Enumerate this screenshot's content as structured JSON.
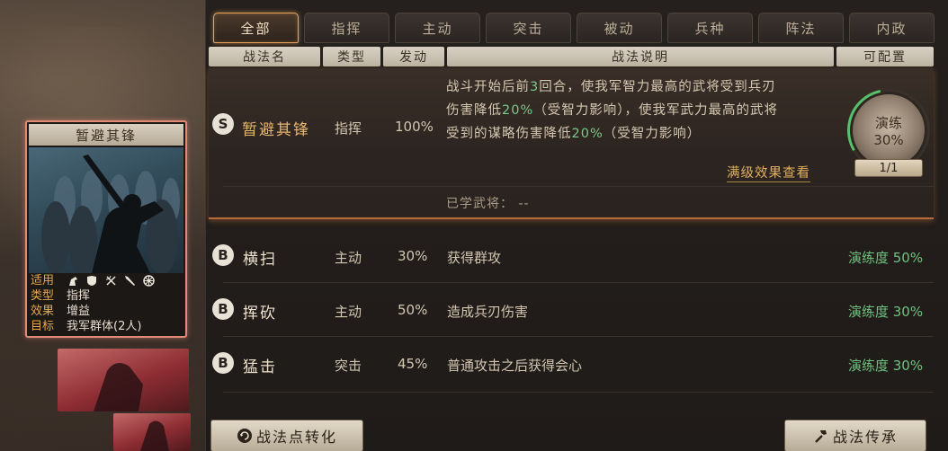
{
  "tabs": [
    "全部",
    "指挥",
    "主动",
    "突击",
    "被动",
    "兵种",
    "阵法",
    "内政"
  ],
  "header": {
    "name": "战法名",
    "type": "类型",
    "rate": "发动",
    "desc": "战法说明",
    "configurable": "可配置"
  },
  "selected": {
    "rank": "S",
    "name": "暂避其锋",
    "type": "指挥",
    "rate": "100%",
    "desc_line1": "战斗开始后前",
    "desc_num1": "3",
    "desc_line1b": "回合，使我军智力最高的武将受到兵刃",
    "desc_line2a": "伤害降低",
    "desc_pct1": "20%",
    "desc_line2b": "（受智力影响），使我军武力最高的武将",
    "desc_line3a": "受到的谋略伤害降低",
    "desc_pct2": "20%",
    "desc_line3b": "（受智力影响）",
    "full_effect_link": "满级效果查看",
    "learned_label": "已学武将：",
    "learned_value": "--",
    "practice_label": "演练",
    "practice_pct": "30%",
    "practice_count": "1/1",
    "practice_progress": 0.3
  },
  "rows": [
    {
      "rank": "B",
      "name": "横扫",
      "type": "主动",
      "rate": "30%",
      "desc": "获得群攻",
      "progress": "演练度 50%"
    },
    {
      "rank": "B",
      "name": "挥砍",
      "type": "主动",
      "rate": "50%",
      "desc": "造成兵刃伤害",
      "progress": "演练度 30%"
    },
    {
      "rank": "B",
      "name": "猛击",
      "type": "突击",
      "rate": "45%",
      "desc": "普通攻击之后获得会心",
      "progress": "演练度 30%"
    }
  ],
  "card": {
    "title": "暂避其锋",
    "applies_label": "适用",
    "type_label": "类型",
    "type_value": "指挥",
    "effect_label": "效果",
    "effect_value": "增益",
    "target_label": "目标",
    "target_value": "我军群体(2人)",
    "arm_icons": [
      "cavalry-icon",
      "shield-icon",
      "bow-icon",
      "spear-icon",
      "wheel-icon"
    ]
  },
  "buttons": {
    "convert": "战法点转化",
    "inherit": "战法传承"
  },
  "colors": {
    "tab_active_border": "#e7a35a",
    "progress_green": "#6fc17f",
    "card_border": "#e28a76",
    "link_gold": "#e2b25f"
  }
}
